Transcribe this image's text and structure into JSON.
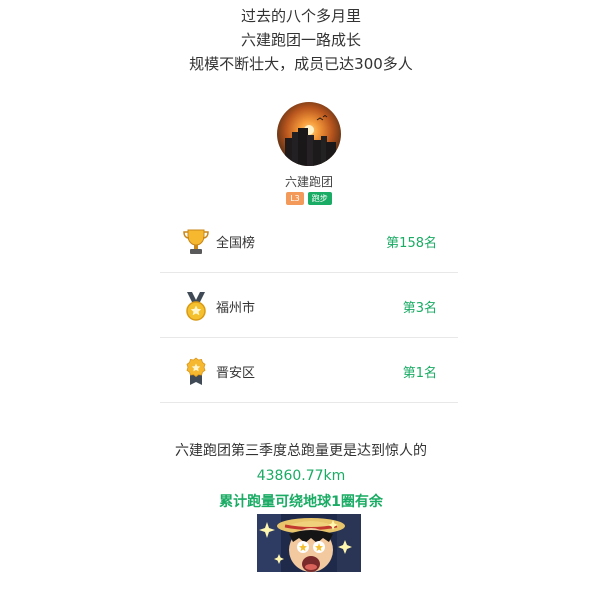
{
  "intro": {
    "line1": "过去的八个多月里",
    "line2": "六建跑团一路成长",
    "line3": "规模不断壮大，成员已达300多人"
  },
  "club": {
    "name": "六建跑团",
    "level": "L3",
    "type": "跑步",
    "level_color": "#f39a5a",
    "type_color": "#1aab64",
    "avatar_icon": "sunset-city-avatar"
  },
  "rankings": [
    {
      "label": "全国榜",
      "value": "第158名",
      "icon": "trophy-icon"
    },
    {
      "label": "福州市",
      "value": "第3名",
      "icon": "gold-medal-icon"
    },
    {
      "label": "晋安区",
      "value": "第1名",
      "icon": "ribbon-medal-icon"
    }
  ],
  "summary": {
    "line1": "六建跑团第三季度总跑量更是达到惊人的",
    "distance": "43860.77km",
    "line3": "累计跑量可绕地球1圈有余"
  },
  "colors": {
    "accent": "#1aab64",
    "text": "#333333",
    "divider": "#e8e8e8"
  },
  "sticker": {
    "icon": "anime-amazed-sticker"
  }
}
